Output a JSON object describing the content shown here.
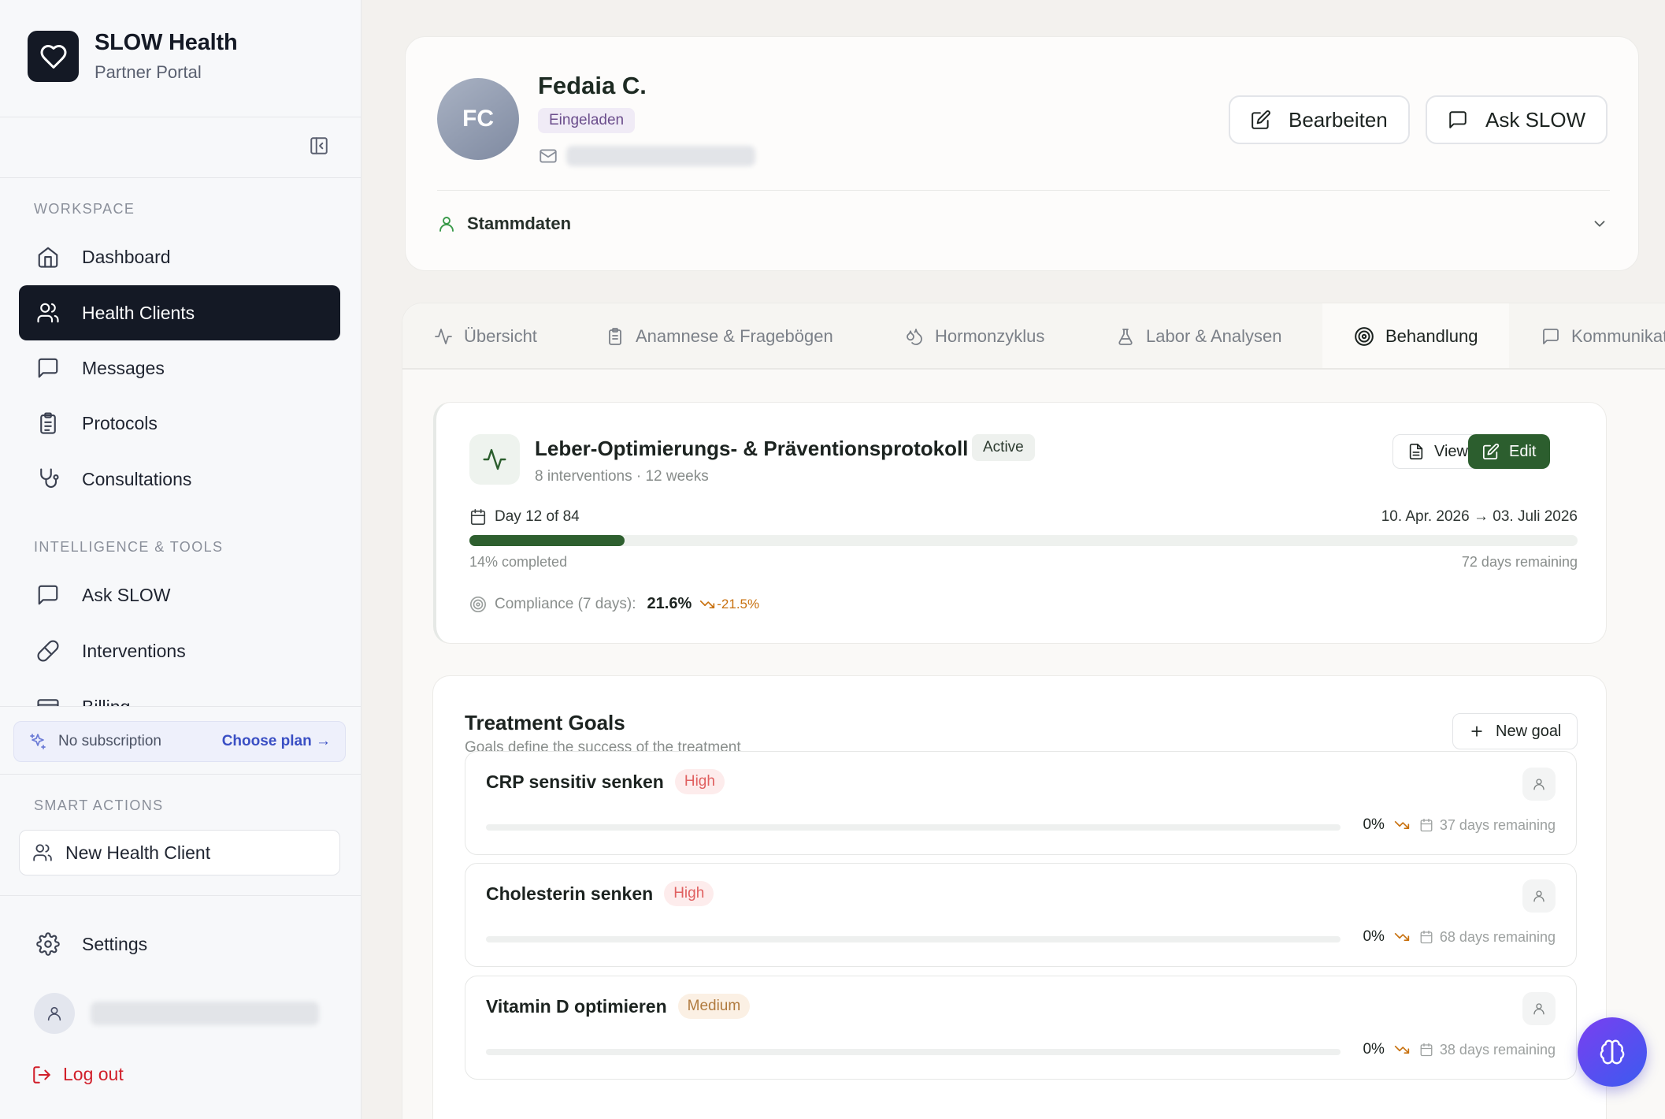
{
  "sidebar": {
    "brand_title": "SLOW Health",
    "brand_subtitle": "Partner Portal",
    "workspace_label": "WORKSPACE",
    "workspace_items": [
      {
        "label": "Dashboard",
        "icon": "home-icon"
      },
      {
        "label": "Health Clients",
        "icon": "users-icon",
        "active": true
      },
      {
        "label": "Messages",
        "icon": "message-icon"
      },
      {
        "label": "Protocols",
        "icon": "clipboard-icon"
      },
      {
        "label": "Consultations",
        "icon": "stethoscope-icon"
      }
    ],
    "tools_label": "INTELLIGENCE & TOOLS",
    "tools_items": [
      {
        "label": "Ask SLOW",
        "icon": "message-icon"
      },
      {
        "label": "Interventions",
        "icon": "pill-icon"
      },
      {
        "label": "Billing",
        "icon": "credit-card-icon"
      }
    ],
    "subscription": {
      "status": "No subscription",
      "cta": "Choose plan →"
    },
    "smart_actions_label": "SMART ACTIONS",
    "new_client_label": "New Health Client",
    "settings_label": "Settings",
    "logout_label": "Log out"
  },
  "profile": {
    "initials": "FC",
    "name": "Fedaia C.",
    "status": "Eingeladen",
    "edit_label": "Bearbeiten",
    "ask_label": "Ask SLOW",
    "section_label": "Stammdaten"
  },
  "tabs": [
    {
      "label": "Übersicht",
      "icon": "activity-icon"
    },
    {
      "label": "Anamnese & Fragebögen",
      "icon": "clipboard-icon"
    },
    {
      "label": "Hormonzyklus",
      "icon": "droplets-icon"
    },
    {
      "label": "Labor & Analysen",
      "icon": "flask-icon"
    },
    {
      "label": "Behandlung",
      "icon": "target-icon",
      "active": true
    },
    {
      "label": "Kommunikation",
      "icon": "message-icon"
    }
  ],
  "protocol": {
    "title": "Leber-Optimierungs- & Präventionsprotokoll",
    "status": "Active",
    "meta": "8 interventions · 12 weeks",
    "view_label": "View",
    "edit_label": "Edit",
    "day_label": "Day 12 of 84",
    "date_range": "10. Apr. 2026 → 03. Juli 2026",
    "progress_fraction": 0.14,
    "completed_label": "14% completed",
    "remaining_label": "72 days remaining",
    "compliance_label": "Compliance (7 days):",
    "compliance_value": "21.6%",
    "compliance_delta": "-21.5%"
  },
  "goals": {
    "title": "Treatment Goals",
    "subtitle": "Goals define the success of the treatment",
    "new_label": "New goal",
    "items": [
      {
        "name": "CRP sensitiv senken",
        "priority": "High",
        "priority_level": "high",
        "percent": "0%",
        "remaining": "37 days remaining"
      },
      {
        "name": "Cholesterin senken",
        "priority": "High",
        "priority_level": "high",
        "percent": "0%",
        "remaining": "68 days remaining"
      },
      {
        "name": "Vitamin D optimieren",
        "priority": "Medium",
        "priority_level": "medium",
        "percent": "0%",
        "remaining": "38 days remaining"
      }
    ]
  },
  "colors": {
    "sidebar_active": "#141925",
    "primary_green": "#2c5e2e",
    "high_priority": "#e06060",
    "medium_priority": "#b07a3e",
    "trend_down": "#c8710f",
    "fab_gradient": "#7a3ff0"
  }
}
